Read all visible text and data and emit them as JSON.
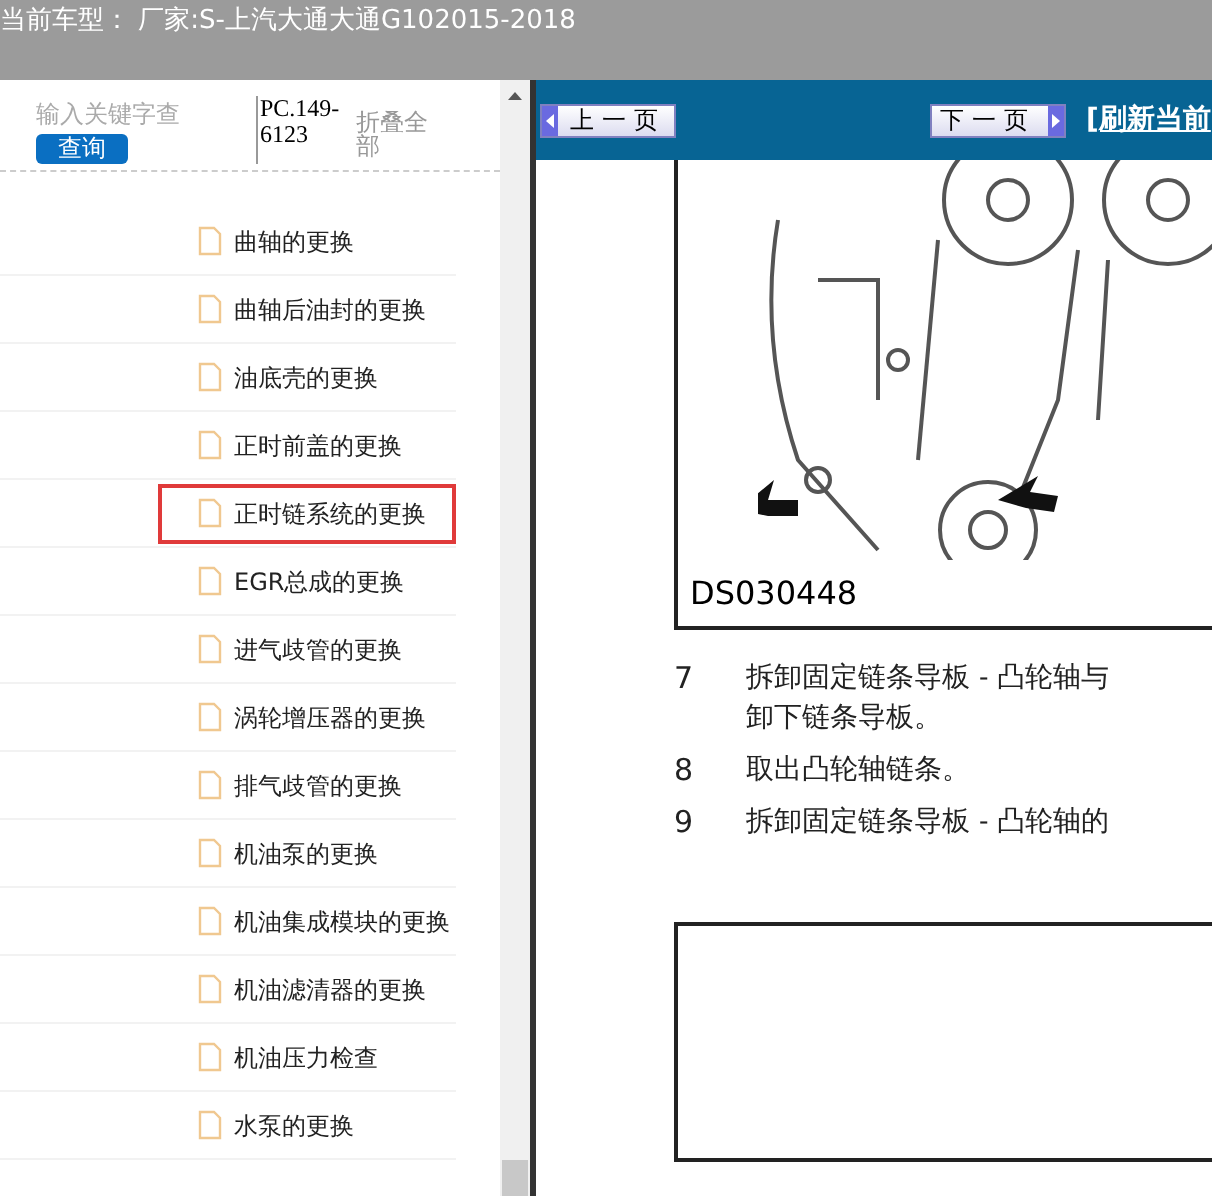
{
  "header": {
    "title": "当前车型： 厂家:S-上汽大通大通G102015-2018"
  },
  "search": {
    "placeholder": "输入关键字查",
    "button": "查询",
    "code": "PC.149-6123",
    "collapse": "折叠全部"
  },
  "tree": {
    "items": [
      {
        "label": "曲轴的更换",
        "selected": false
      },
      {
        "label": "曲轴后油封的更换",
        "selected": false
      },
      {
        "label": "油底壳的更换",
        "selected": false
      },
      {
        "label": "正时前盖的更换",
        "selected": false
      },
      {
        "label": "正时链系统的更换",
        "selected": true
      },
      {
        "label": "EGR总成的更换",
        "selected": false
      },
      {
        "label": "进气歧管的更换",
        "selected": false
      },
      {
        "label": "涡轮增压器的更换",
        "selected": false
      },
      {
        "label": "排气歧管的更换",
        "selected": false
      },
      {
        "label": "机油泵的更换",
        "selected": false
      },
      {
        "label": "机油集成模块的更换",
        "selected": false
      },
      {
        "label": "机油滤清器的更换",
        "selected": false
      },
      {
        "label": "机油压力检查",
        "selected": false
      },
      {
        "label": "水泵的更换",
        "selected": false
      }
    ]
  },
  "toolbar": {
    "prev": "上一页",
    "next": "下一页",
    "refresh": "[刷新当前"
  },
  "document": {
    "figure_label": "DS030448",
    "steps": [
      {
        "number": "7",
        "lines": [
          "拆卸固定链条导板 - 凸轮轴与",
          "卸下链条导板。"
        ]
      },
      {
        "number": "8",
        "lines": [
          "取出凸轮轴链条。"
        ]
      },
      {
        "number": "9",
        "lines": [
          "拆卸固定链条导板 - 凸轮轴的"
        ]
      }
    ]
  }
}
